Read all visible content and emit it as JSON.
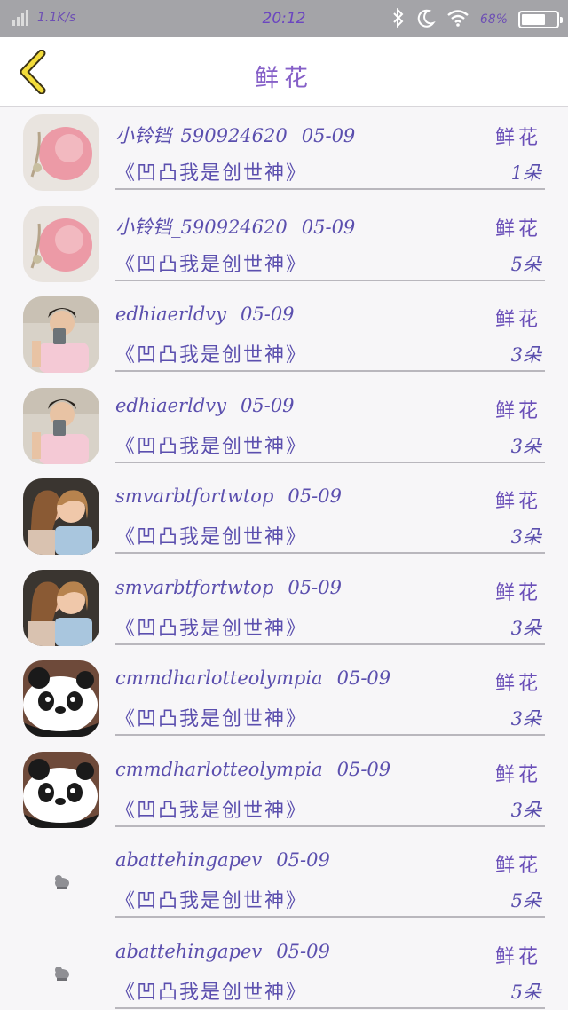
{
  "status_bar": {
    "network_speed": "1.1K/s",
    "time": "20:12",
    "battery_text": "68%",
    "battery_level": 0.68
  },
  "header": {
    "title": "鲜花"
  },
  "colors": {
    "accent": "#6a4fb8",
    "divider": "#b9b7bd",
    "back_icon_outline": "#3a3216",
    "back_icon_fill": "#f3dc3a"
  },
  "gifts": [
    {
      "user": "小铃铛_590924620",
      "date": "05-09",
      "gift": "鲜花",
      "work": "《凹凸我是创世神》",
      "count": "1朵",
      "avatar": "flower-avatar"
    },
    {
      "user": "小铃铛_590924620",
      "date": "05-09",
      "gift": "鲜花",
      "work": "《凹凸我是创世神》",
      "count": "5朵",
      "avatar": "flower-avatar"
    },
    {
      "user": "edhiaerldvy",
      "date": "05-09",
      "gift": "鲜花",
      "work": "《凹凸我是创世神》",
      "count": "3朵",
      "avatar": "selfie-avatar"
    },
    {
      "user": "edhiaerldvy",
      "date": "05-09",
      "gift": "鲜花",
      "work": "《凹凸我是创世神》",
      "count": "3朵",
      "avatar": "selfie-avatar"
    },
    {
      "user": "smvarbtfortwtop",
      "date": "05-09",
      "gift": "鲜花",
      "work": "《凹凸我是创世神》",
      "count": "3朵",
      "avatar": "girls-avatar"
    },
    {
      "user": "smvarbtfortwtop",
      "date": "05-09",
      "gift": "鲜花",
      "work": "《凹凸我是创世神》",
      "count": "3朵",
      "avatar": "girls-avatar"
    },
    {
      "user": "cmmdharlotteolympia",
      "date": "05-09",
      "gift": "鲜花",
      "work": "《凹凸我是创世神》",
      "count": "3朵",
      "avatar": "panda-avatar"
    },
    {
      "user": "cmmdharlotteolympia",
      "date": "05-09",
      "gift": "鲜花",
      "work": "《凹凸我是创世神》",
      "count": "3朵",
      "avatar": "panda-avatar"
    },
    {
      "user": "abattehingapev",
      "date": "05-09",
      "gift": "鲜花",
      "work": "《凹凸我是创世神》",
      "count": "5朵",
      "avatar": "default-avatar"
    },
    {
      "user": "abattehingapev",
      "date": "05-09",
      "gift": "鲜花",
      "work": "《凹凸我是创世神》",
      "count": "5朵",
      "avatar": "default-avatar"
    }
  ]
}
